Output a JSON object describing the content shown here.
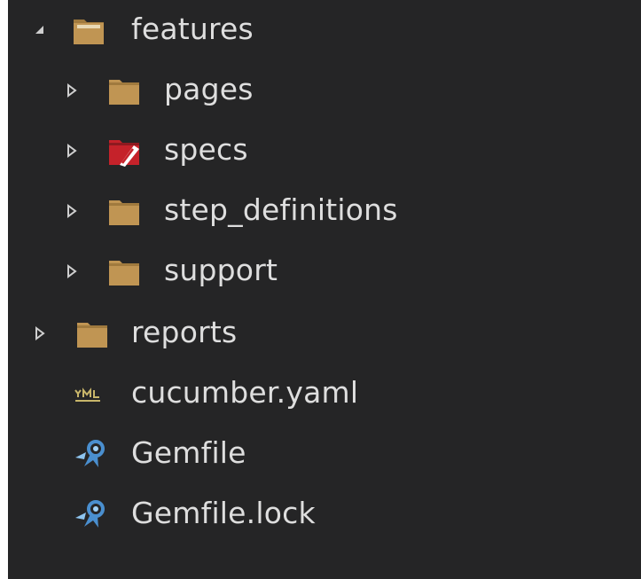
{
  "tree": {
    "items": [
      {
        "label": "features",
        "icon": "folder-open-icon",
        "expanded": true,
        "depth": 0
      },
      {
        "label": "pages",
        "icon": "folder-icon",
        "expanded": false,
        "depth": 1
      },
      {
        "label": "specs",
        "icon": "folder-test-icon",
        "expanded": false,
        "depth": 1
      },
      {
        "label": "step_definitions",
        "icon": "folder-icon",
        "expanded": false,
        "depth": 1
      },
      {
        "label": "support",
        "icon": "folder-icon",
        "expanded": false,
        "depth": 1
      },
      {
        "label": "reports",
        "icon": "folder-icon",
        "expanded": false,
        "depth": 0
      },
      {
        "label": "cucumber.yaml",
        "icon": "yaml-file-icon",
        "depth": 0
      },
      {
        "label": "Gemfile",
        "icon": "ruby-gem-icon",
        "depth": 0
      },
      {
        "label": "Gemfile.lock",
        "icon": "ruby-gem-icon",
        "depth": 0
      }
    ]
  },
  "colors": {
    "background": "#252526",
    "text": "#dedede",
    "folder": "#c09553",
    "test_folder": "#c5222a",
    "yaml_icon": "#c8b66a",
    "ruby_icon": "#4a8fcf"
  }
}
